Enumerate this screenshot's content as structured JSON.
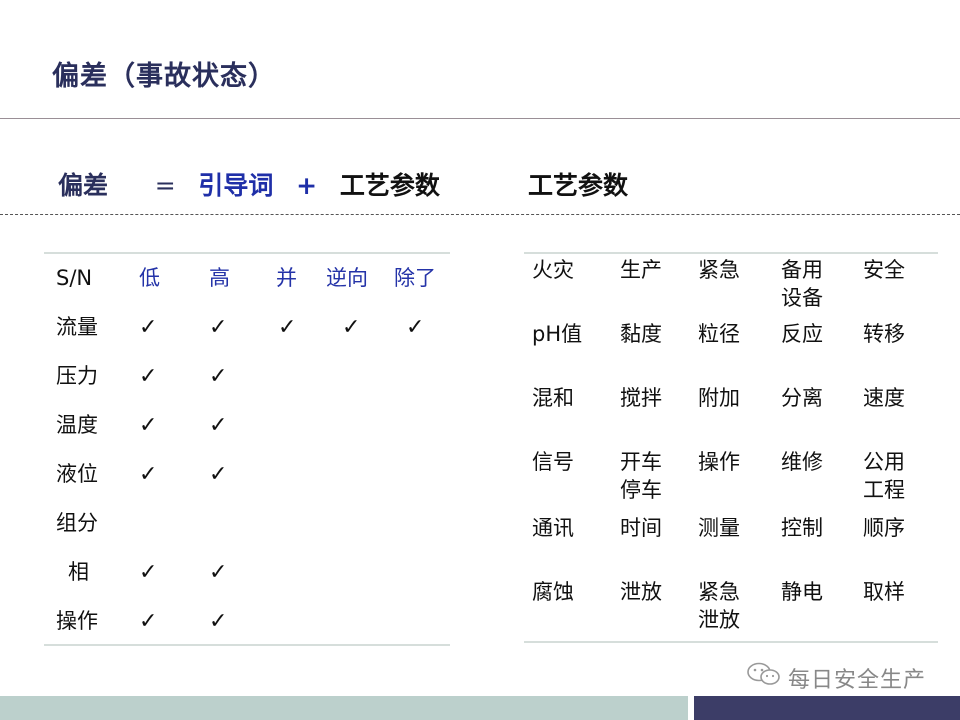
{
  "title": "偏差（事故状态）",
  "formula": {
    "deviation": "偏差",
    "equals": "=",
    "guide_word": "引导词",
    "plus": "+",
    "param": "工艺参数"
  },
  "right_heading": "工艺参数",
  "left_table": {
    "headers": [
      "S/N",
      "低",
      "高",
      "并",
      "逆向",
      "除了"
    ],
    "check_glyph": "✓",
    "rows": [
      {
        "param": "流量",
        "checks": [
          true,
          true,
          true,
          true,
          true
        ]
      },
      {
        "param": "压力",
        "checks": [
          true,
          true,
          false,
          false,
          false
        ]
      },
      {
        "param": "温度",
        "checks": [
          true,
          true,
          false,
          false,
          false
        ]
      },
      {
        "param": "液位",
        "checks": [
          true,
          true,
          false,
          false,
          false
        ]
      },
      {
        "param": "组分",
        "checks": [
          false,
          false,
          false,
          false,
          false
        ]
      },
      {
        "param": "相",
        "checks": [
          true,
          true,
          false,
          false,
          false
        ]
      },
      {
        "param": "操作",
        "checks": [
          true,
          true,
          false,
          false,
          false
        ]
      }
    ]
  },
  "right_table": {
    "rows": [
      [
        "火灾",
        "生产",
        "紧急",
        "备用\n设备",
        "安全"
      ],
      [
        "pH值",
        "黏度",
        "粒径",
        "反应",
        "转移"
      ],
      [
        "混和",
        "搅拌",
        "附加",
        "分离",
        "速度"
      ],
      [
        "信号",
        "开车\n停车",
        "操作",
        "维修",
        "公用\n工程"
      ],
      [
        "通讯",
        "时间",
        "测量",
        "控制",
        "顺序"
      ],
      [
        "腐蚀",
        "泄放",
        "紧急\n泄放",
        "静电",
        "取样"
      ]
    ]
  },
  "watermark": "每日安全生产",
  "colors": {
    "title": "#2a2f5c",
    "guide_word": "#1f2fa8",
    "bar_left": "#bcd0cc",
    "bar_right": "#3c3d67"
  }
}
